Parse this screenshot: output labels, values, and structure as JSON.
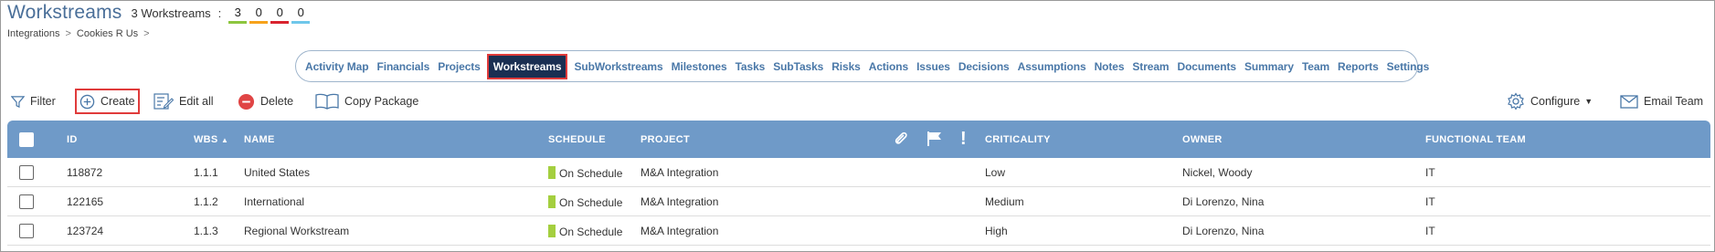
{
  "header": {
    "title": "Workstreams",
    "count_label": "3 Workstreams",
    "colon": ":",
    "status_counts": [
      {
        "value": "3",
        "color": "#8dc63f"
      },
      {
        "value": "0",
        "color": "#f7a21b"
      },
      {
        "value": "0",
        "color": "#d9232e"
      },
      {
        "value": "0",
        "color": "#6fc7ea"
      }
    ]
  },
  "breadcrumb": {
    "items": [
      "Integrations",
      "Cookies R Us"
    ],
    "separator": ">"
  },
  "nav": {
    "tabs": [
      {
        "label": "Activity Map"
      },
      {
        "label": "Financials"
      },
      {
        "label": "Projects"
      },
      {
        "label": "Workstreams",
        "active": true
      },
      {
        "label": "SubWorkstreams"
      },
      {
        "label": "Milestones"
      },
      {
        "label": "Tasks"
      },
      {
        "label": "SubTasks"
      },
      {
        "label": "Risks"
      },
      {
        "label": "Actions"
      },
      {
        "label": "Issues"
      },
      {
        "label": "Decisions"
      },
      {
        "label": "Assumptions"
      },
      {
        "label": "Notes"
      },
      {
        "label": "Stream"
      },
      {
        "label": "Documents"
      },
      {
        "label": "Summary"
      },
      {
        "label": "Team"
      },
      {
        "label": "Reports"
      },
      {
        "label": "Settings"
      }
    ]
  },
  "toolbar": {
    "filter_label": "Filter",
    "create_label": "Create",
    "edit_all_label": "Edit all",
    "delete_label": "Delete",
    "copy_package_label": "Copy Package",
    "configure_label": "Configure",
    "email_team_label": "Email Team"
  },
  "table": {
    "columns": {
      "id": "ID",
      "wbs": "WBS",
      "name": "NAME",
      "schedule": "SCHEDULE",
      "project": "PROJECT",
      "criticality": "CRITICALITY",
      "owner": "OWNER",
      "functional_team": "FUNCTIONAL TEAM"
    },
    "rows": [
      {
        "id": "118872",
        "wbs": "1.1.1",
        "name": "United States",
        "schedule": "On Schedule",
        "project": "M&A Integration",
        "criticality": "Low",
        "owner": "Nickel, Woody",
        "team": "IT"
      },
      {
        "id": "122165",
        "wbs": "1.1.2",
        "name": "International",
        "schedule": "On Schedule",
        "project": "M&A Integration",
        "criticality": "Medium",
        "owner": "Di Lorenzo, Nina",
        "team": "IT"
      },
      {
        "id": "123724",
        "wbs": "1.1.3",
        "name": "Regional Workstream",
        "schedule": "On Schedule",
        "project": "M&A Integration",
        "criticality": "High",
        "owner": "Di Lorenzo, Nina",
        "team": "IT"
      }
    ],
    "schedule_color": "#a4cf3f"
  },
  "colors": {
    "accent": "#4a78a8",
    "header_bg": "#6f9ac8",
    "active_tab_bg": "#1a2f52",
    "highlight_border": "#e03b3b"
  }
}
